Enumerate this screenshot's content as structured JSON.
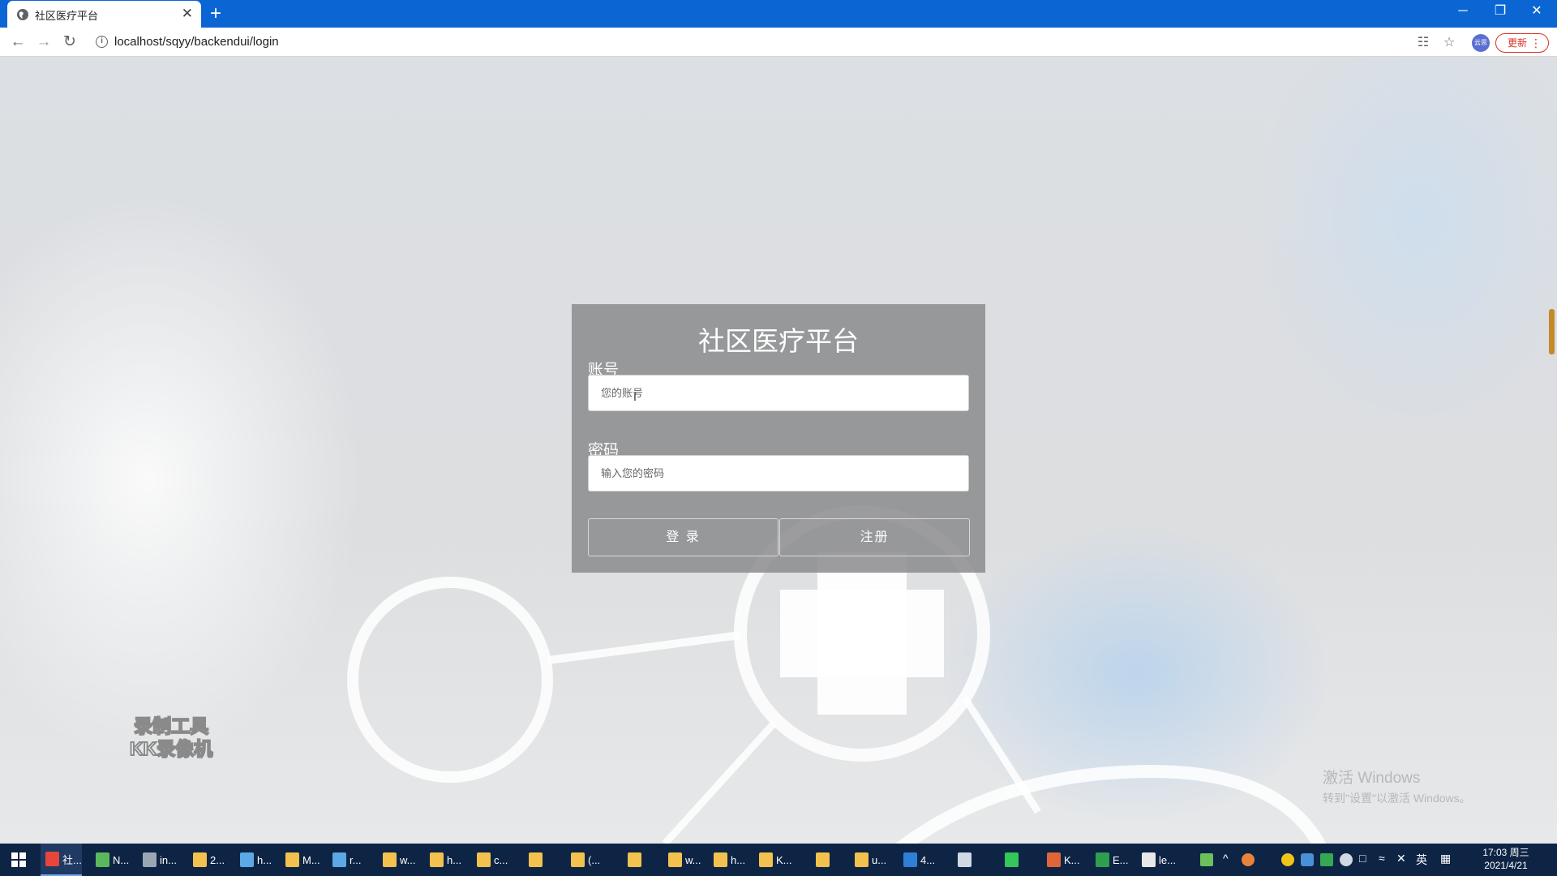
{
  "browser": {
    "tab_title": "社区医疗平台",
    "tab_close": "✕",
    "new_tab": "+",
    "url": "localhost/sqyy/backendui/login",
    "profile_label": "云思",
    "update_label": "更新",
    "update_menu": "⋮",
    "window_controls": {
      "minimize": "─",
      "restore": "❐",
      "close": "✕"
    },
    "nav_icons": [
      "back-icon",
      "forward-icon",
      "reload-icon",
      "info-icon",
      "translate-icon",
      "star-icon"
    ]
  },
  "login": {
    "title": "社区医疗平台",
    "account_label": "账号",
    "account_placeholder": "您的账号",
    "password_label": "密码",
    "password_placeholder": "输入您的密码",
    "login_button": "登 录",
    "register_button": "注册"
  },
  "overlay": {
    "watermark_line1": "录制工具",
    "watermark_line2": "KK录像机",
    "activate_line1": "激活 Windows",
    "activate_line2": "转到\"设置\"以激活 Windows。"
  },
  "taskbar": {
    "tasks": [
      {
        "label": "社...",
        "color": "#e8453c",
        "active": true
      },
      {
        "label": "N...",
        "color": "#5cb85c"
      },
      {
        "label": "in...",
        "color": "#9aa6b2"
      },
      {
        "label": "2...",
        "color": "#f2c14e"
      },
      {
        "label": "h...",
        "color": "#5aa9e6"
      },
      {
        "label": "M...",
        "color": "#f2c14e"
      },
      {
        "label": "r...",
        "color": "#5aa9e6"
      },
      {
        "label": "w...",
        "color": "#f2c14e"
      },
      {
        "label": "h...",
        "color": "#f2c14e"
      },
      {
        "label": "c...",
        "color": "#f2c14e"
      },
      {
        "label": "",
        "color": "#f2c14e"
      },
      {
        "label": "(...",
        "color": "#f2c14e"
      },
      {
        "label": "",
        "color": "#f2c14e"
      },
      {
        "label": "w...",
        "color": "#f2c14e"
      },
      {
        "label": "h...",
        "color": "#f2c14e"
      },
      {
        "label": "K...",
        "color": "#f2c14e"
      },
      {
        "label": "",
        "color": "#f2c14e"
      },
      {
        "label": "u...",
        "color": "#f2c14e"
      },
      {
        "label": "4...",
        "color": "#2f7fd6"
      },
      {
        "label": "",
        "color": "#cfd8e3"
      },
      {
        "label": "",
        "color": "#34c759"
      },
      {
        "label": "K...",
        "color": "#e0663a"
      },
      {
        "label": "E...",
        "color": "#2e9e4f"
      },
      {
        "label": "le...",
        "color": "#e8e8e8"
      }
    ],
    "ime": "英",
    "time": "17:03 周三",
    "date": "2021/4/21"
  }
}
